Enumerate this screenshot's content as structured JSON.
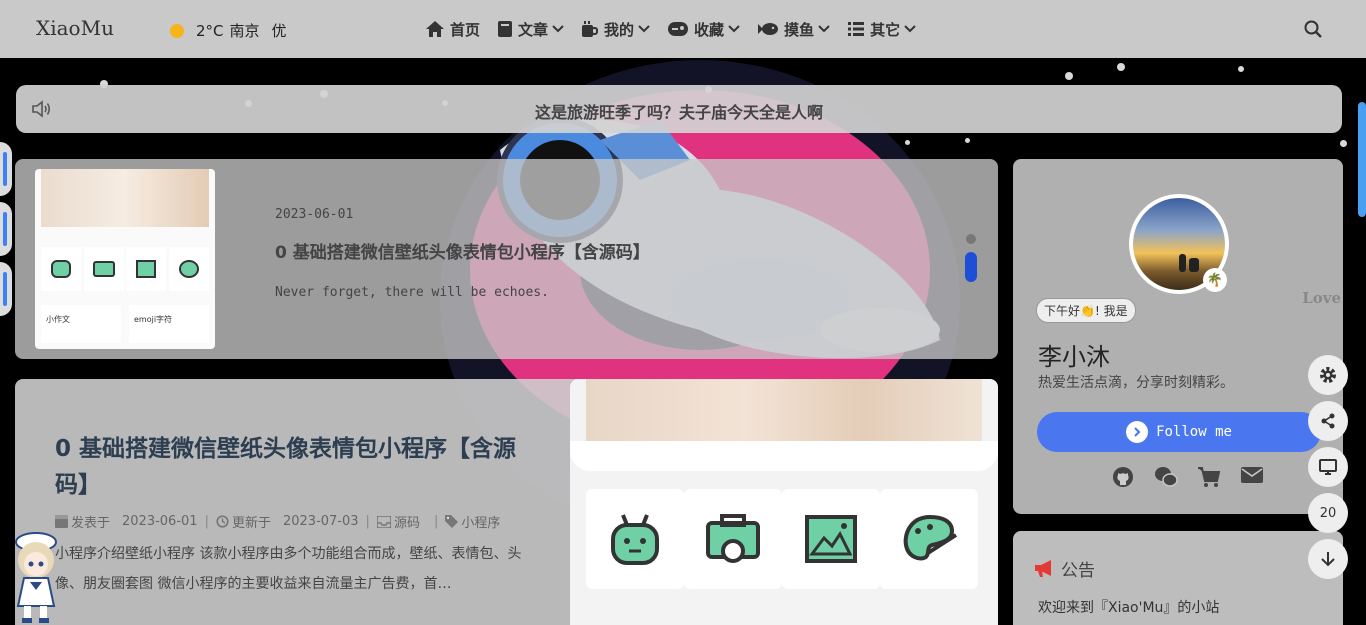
{
  "nav": {
    "logo": "XiaoMu",
    "weather": {
      "temp": "2°C",
      "city": "南京",
      "quality": "优"
    },
    "menu": [
      {
        "label": "首页",
        "icon": "home-icon",
        "dropdown": false
      },
      {
        "label": "文章",
        "icon": "book-icon",
        "dropdown": true
      },
      {
        "label": "我的",
        "icon": "mug-icon",
        "dropdown": true
      },
      {
        "label": "收藏",
        "icon": "gamepad-icon",
        "dropdown": true
      },
      {
        "label": "摸鱼",
        "icon": "fish-icon",
        "dropdown": true
      },
      {
        "label": "其它",
        "icon": "list-icon",
        "dropdown": true
      }
    ]
  },
  "notice_bar": {
    "text": "这是旅游旺季了吗？夫子庙今天全是人啊"
  },
  "featured": {
    "date": "2023-06-01",
    "title": "0 基础搭建微信壁纸头像表情包小程序【含源码】",
    "quote": "Never forget, there will be echoes.",
    "thumb_labels": [
      "小作文",
      "emoji字符"
    ]
  },
  "article": {
    "title": "0 基础搭建微信壁纸头像表情包小程序【含源码】",
    "meta": {
      "published_label": "发表于",
      "published": "2023-06-01",
      "updated_label": "更新于",
      "updated": "2023-07-03",
      "category": "源码",
      "tag": "小程序"
    },
    "excerpt": "小程序介绍壁纸小程序 该款小程序由多个功能组合而成，壁纸、表情包、头像、朋友圈套图 微信小程序的主要收益来自流量主广告费，首…"
  },
  "profile": {
    "greeting": "下午好👏! 我是",
    "name": "李小沐",
    "bio": "热爱生活点滴，分享时刻精彩。",
    "follow_label": "Follow me",
    "love": "Love",
    "badge": "🌴",
    "socials": [
      "github-icon",
      "wechat-icon",
      "cart-icon",
      "mail-icon"
    ]
  },
  "board": {
    "title": "公告",
    "text": "欢迎来到『Xiao'Mu』的小站"
  },
  "tools": {
    "progress": "20"
  },
  "colors": {
    "accent": "#4a76f0",
    "nav_bg": "#c9c9c9",
    "indicator": "#1d4ed8",
    "announce": "#e53935"
  }
}
